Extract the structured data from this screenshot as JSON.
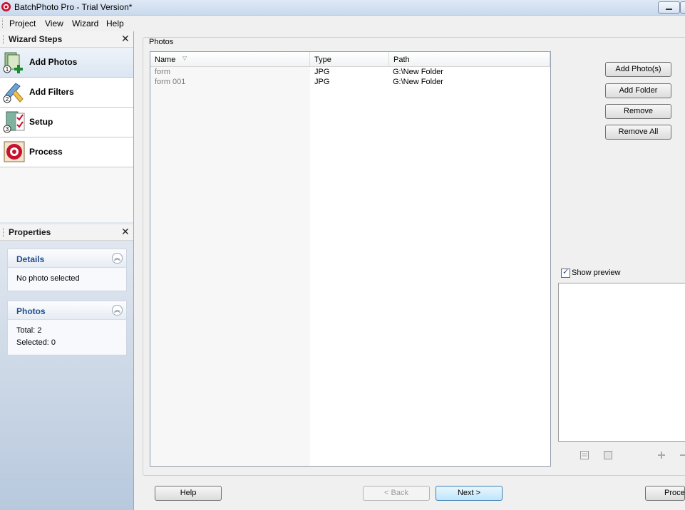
{
  "window": {
    "title": "BatchPhoto Pro - Trial Version*",
    "brand_color": "#c8102e"
  },
  "menubar": {
    "items": [
      {
        "label": "Project"
      },
      {
        "label": "View"
      },
      {
        "label": "Wizard"
      },
      {
        "label": "Help"
      }
    ]
  },
  "wizard": {
    "title": "Wizard Steps",
    "close_label": "✕",
    "steps": [
      {
        "number": "1",
        "label": "Add Photos",
        "icon": "add-photos-icon",
        "active": true
      },
      {
        "number": "2",
        "label": "Add Filters",
        "icon": "add-filters-icon"
      },
      {
        "number": "3",
        "label": "Setup",
        "icon": "setup-icon"
      },
      {
        "number": "",
        "label": "Process",
        "icon": "process-icon"
      }
    ]
  },
  "properties": {
    "title": "Properties",
    "close_label": "✕",
    "details": {
      "title": "Details",
      "text": "No photo selected"
    },
    "photos": {
      "title": "Photos",
      "total": "Total: 2",
      "selected": "Selected: 0"
    }
  },
  "photos_group": {
    "label": "Photos",
    "columns": [
      "Name",
      "Type",
      "Path"
    ],
    "rows": [
      {
        "name": "form",
        "type": "JPG",
        "path": "G:\\New Folder"
      },
      {
        "name": "form 001",
        "type": "JPG",
        "path": "G:\\New Folder"
      }
    ],
    "buttons": {
      "add_photos": "Add Photo(s)",
      "add_folder": "Add Folder",
      "remove": "Remove",
      "remove_all": "Remove All"
    },
    "show_preview": "Show preview"
  },
  "bottom": {
    "help": "Help",
    "back": "< Back",
    "next": "Next >",
    "process": "Process"
  }
}
